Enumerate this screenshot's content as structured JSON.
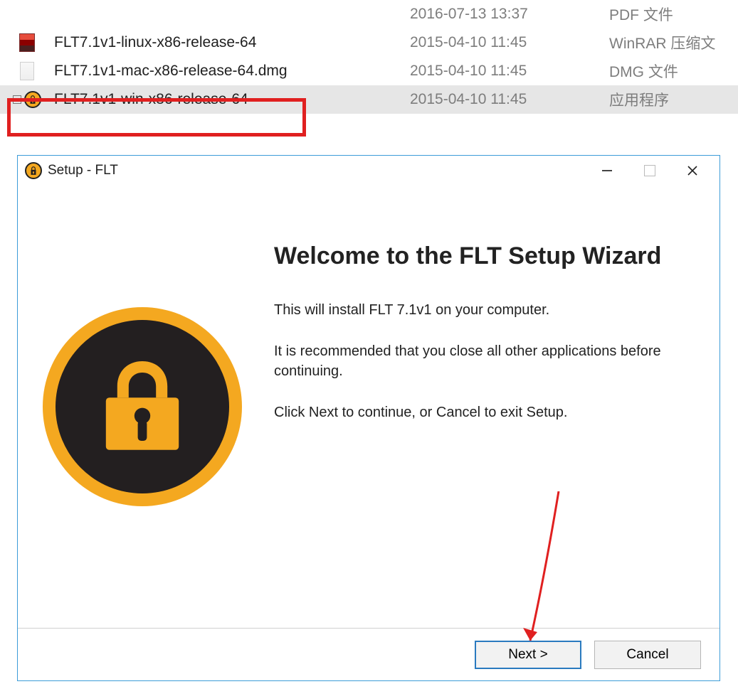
{
  "files": [
    {
      "name": "",
      "date": "2016-07-13 13:37",
      "type": "PDF 文件",
      "icon": "blank"
    },
    {
      "name": "FLT7.1v1-linux-x86-release-64",
      "date": "2015-04-10 11:45",
      "type": "WinRAR 压缩文",
      "icon": "rar"
    },
    {
      "name": "FLT7.1v1-mac-x86-release-64.dmg",
      "date": "2015-04-10 11:45",
      "type": "DMG 文件",
      "icon": "blank"
    },
    {
      "name": "FLT7.1v1-win-x86-release-64",
      "date": "2015-04-10 11:45",
      "type": "应用程序",
      "icon": "lock",
      "selected": true
    }
  ],
  "dialog": {
    "title": "Setup - FLT",
    "heading": "Welcome to the FLT Setup Wizard",
    "body1": "This will install FLT 7.1v1 on your computer.",
    "body2": "It is recommended that you close all other applications before continuing.",
    "body3": "Click Next to continue, or Cancel to exit Setup.",
    "next": "Next >",
    "cancel": "Cancel"
  }
}
